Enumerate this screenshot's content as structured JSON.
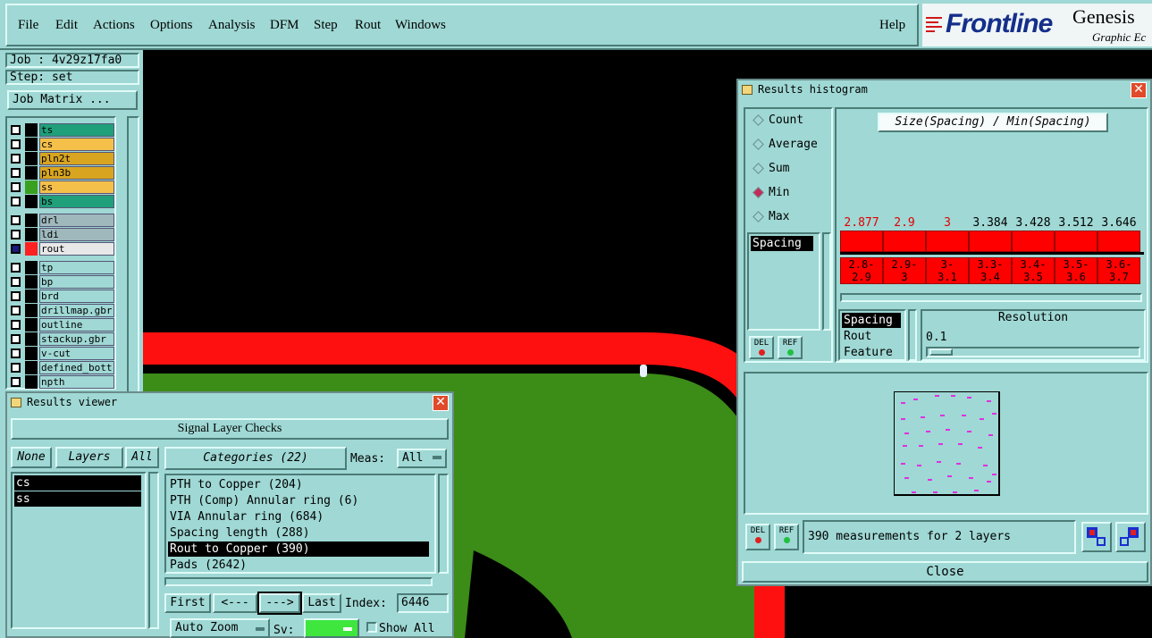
{
  "menu": {
    "items": [
      "File",
      "Edit",
      "Actions",
      "Options",
      "Analysis",
      "DFM",
      "Step",
      "Rout",
      "Windows"
    ],
    "help": "Help"
  },
  "logo": {
    "brand": "Frontline",
    "product": "Genesis",
    "subtitle": "Graphic Ec"
  },
  "job": {
    "job_label": "Job : 4v29z17fa0",
    "step_label": "Step: set",
    "matrix_button": "Job Matrix ..."
  },
  "layers": [
    {
      "name": "ts",
      "color": "#1fa07a",
      "swatch": "#000000"
    },
    {
      "name": "cs",
      "color": "#f5c04a",
      "swatch": "#000000"
    },
    {
      "name": "pln2t",
      "color": "#d9a520",
      "swatch": "#000000"
    },
    {
      "name": "pln3b",
      "color": "#d9a520",
      "swatch": "#000000"
    },
    {
      "name": "ss",
      "color": "#f5c04a",
      "swatch": "#3aa020"
    },
    {
      "name": "bs",
      "color": "#1fa07a",
      "swatch": "#000000"
    },
    {
      "name": "drl",
      "color": "#9fb8bc",
      "swatch": "#000000"
    },
    {
      "name": "ldi",
      "color": "#9fb8bc",
      "swatch": "#000000"
    },
    {
      "name": "rout",
      "color": "#e8e8e8",
      "swatch": "#ff2020"
    },
    {
      "name": "tp",
      "color": "#9fd8d4",
      "swatch": "#000000"
    },
    {
      "name": "bp",
      "color": "#9fd8d4",
      "swatch": "#000000"
    },
    {
      "name": "brd",
      "color": "#9fd8d4",
      "swatch": "#000000"
    },
    {
      "name": "drillmap.gbr",
      "color": "#9fd8d4",
      "swatch": "#000000"
    },
    {
      "name": "outline",
      "color": "#9fd8d4",
      "swatch": "#000000"
    },
    {
      "name": "stackup.gbr",
      "color": "#9fd8d4",
      "swatch": "#000000"
    },
    {
      "name": "v-cut",
      "color": "#9fd8d4",
      "swatch": "#000000"
    },
    {
      "name": "defined_bott",
      "color": "#9fd8d4",
      "swatch": "#000000"
    },
    {
      "name": "npth",
      "color": "#9fd8d4",
      "swatch": "#000000"
    }
  ],
  "results_viewer": {
    "title": "Results viewer",
    "header": "Signal Layer Checks",
    "none_btn": "None",
    "layers_btn": "Layers",
    "all_btn": "All",
    "categories_btn": "Categories (22)",
    "meas_label": "Meas:",
    "meas_value": "All",
    "layer_list": [
      "cs",
      "ss"
    ],
    "categories": [
      "PTH to Copper (204)",
      "PTH (Comp) Annular ring (6)",
      "VIA Annular ring (684)",
      "Spacing length (288)",
      "Rout to Copper (390)",
      "Pads (2642)"
    ],
    "selected_category": 4,
    "first_btn": "First",
    "prev_btn": "<---",
    "next_btn": "--->",
    "last_btn": "Last",
    "index_label": "Index:",
    "index_value": "6446",
    "auto_zoom": "Auto Zoom",
    "sv_label": "Sv:",
    "show_all": "Show All"
  },
  "histogram": {
    "title": "Results histogram",
    "chart_title": "Size(Spacing) / Min(Spacing)",
    "options": [
      "Count",
      "Average",
      "Sum",
      "Min",
      "Max"
    ],
    "selected_option": "Min",
    "list1": [
      "Spacing"
    ],
    "values": [
      "2.877",
      "2.9",
      "3",
      "3.384",
      "3.428",
      "3.512",
      "3.646"
    ],
    "value_colors": [
      "#e00000",
      "#e00000",
      "#e00000",
      "#000000",
      "#000000",
      "#000000",
      "#000000"
    ],
    "bins": [
      "2.8-\n2.9",
      "2.9-\n3",
      "3-\n3.1",
      "3.3-\n3.4",
      "3.4-\n3.5",
      "3.5-\n3.6",
      "3.6-\n3.7"
    ],
    "list2": [
      "Spacing",
      "Rout",
      "Feature"
    ],
    "resolution_label": "Resolution",
    "resolution_value": "0.1",
    "del_label": "DEL",
    "ref_label": "REF",
    "status": "390 measurements for 2 layers",
    "close_btn": "Close"
  }
}
